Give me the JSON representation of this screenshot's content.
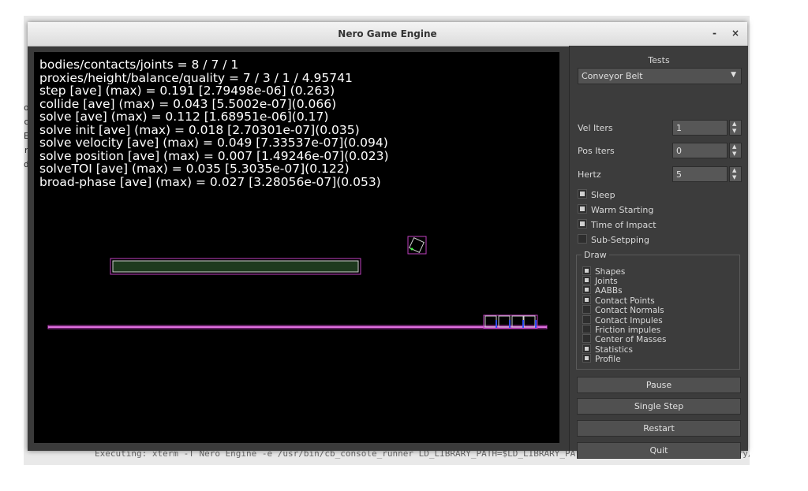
{
  "window": {
    "title": "Nero Game Engine",
    "minimize_glyph": "-",
    "close_glyph": "×"
  },
  "background": {
    "status_text": "Executing: xterm -T Nero Engine -e /usr/bin/cb_console_runner LD_LIBRARY_PATH=$LD_LIBRARY_PATH:.:/home/landry/Desktop/library/lib /h",
    "side_chars": [
      "ol",
      "c:",
      "E",
      "re",
      "d"
    ]
  },
  "stats": [
    "bodies/contacts/joints = 8 / 7 / 1",
    "proxies/height/balance/quality = 7 / 3 / 1 / 4.95741",
    "step [ave] (max) = 0.191 [2.79498e-06]  (0.263)",
    "collide [ave] (max) = 0.043 [5.5002e-07](0.066)",
    "solve [ave] (max) = 0.112 [1.68951e-06](0.17)",
    "solve init [ave] (max) = 0.018 [2.70301e-07](0.035)",
    "solve velocity [ave] (max) = 0.049 [7.33537e-07](0.094)",
    "solve position [ave] (max) = 0.007 [1.49246e-07](0.023)",
    "solveTOI [ave] (max) = 0.035 [5.3035e-07](0.122)",
    "broad-phase [ave] (max) = 0.027 [3.28056e-07](0.053)"
  ],
  "panel": {
    "tests_label": "Tests",
    "selected_test": "Conveyor Belt",
    "vel_iters": {
      "label": "Vel Iters",
      "value": "1"
    },
    "pos_iters": {
      "label": "Pos Iters",
      "value": "0"
    },
    "hertz": {
      "label": "Hertz",
      "value": "5"
    },
    "options": [
      {
        "label": "Sleep",
        "checked": true
      },
      {
        "label": "Warm Starting",
        "checked": true
      },
      {
        "label": "Time of Impact",
        "checked": true
      },
      {
        "label": "Sub-Setpping",
        "checked": false
      }
    ],
    "draw_label": "Draw",
    "draw_options": [
      {
        "label": "Shapes",
        "checked": true
      },
      {
        "label": "Joints",
        "checked": true
      },
      {
        "label": "AABBs",
        "checked": true
      },
      {
        "label": "Contact Points",
        "checked": true
      },
      {
        "label": "Contact Normals",
        "checked": false
      },
      {
        "label": "Contact Impules",
        "checked": false
      },
      {
        "label": "Friction impules",
        "checked": false
      },
      {
        "label": "Center of Masses",
        "checked": false
      },
      {
        "label": "Statistics",
        "checked": true
      },
      {
        "label": "Profile",
        "checked": true
      }
    ],
    "buttons": {
      "pause": "Pause",
      "single_step": "Single Step",
      "restart": "Restart",
      "quit": "Quit"
    }
  },
  "colors": {
    "aabb": "#c040c0",
    "ground": "#e070e0",
    "platform_fill": "#1e3a1e",
    "body_outline": "#d0d0d0",
    "contact_point": "#3050ff"
  }
}
